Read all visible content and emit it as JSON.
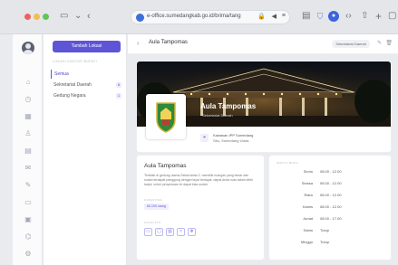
{
  "browser": {
    "url": "e-office.sumedangkab.go.id/brima/tang"
  },
  "sidebar_panel": {
    "add_button": "Tambah Lokasi",
    "caption": "LOKASI KANTOR BUPATI",
    "items": [
      {
        "label": "Semua",
        "count": ""
      },
      {
        "label": "Sekretariat Daerah",
        "count": "8"
      },
      {
        "label": "Gedung Negara",
        "count": "1"
      }
    ]
  },
  "header": {
    "title": "Aula Tampomas",
    "chip": "Sekretariat Daerah"
  },
  "hero": {
    "name": "Aula Tampomas",
    "subtitle": "Sekretariat Daerah",
    "location_line1": "Kawasan IPP Sumedang",
    "location_line2": "Situ, Sumedang Utara"
  },
  "info": {
    "title": "Aula Tampomas",
    "description": "Terletak di gedung utama Setda lantai 2, memiliki ruangan yang besar dan sudah terdapat panggung dengan layar berlayar, dapat Anda ruas tabah lebih lanjut, untuk penyewaan ini dapat bisa sudah.",
    "capacity_caption": "KAPASITAS",
    "capacity_value": "60-100 orang",
    "facility_caption": "FASILITAS"
  },
  "hours": {
    "caption": "WAKTU BUKA",
    "rows": [
      {
        "day": "Senin",
        "time": "08.00 - 12.00"
      },
      {
        "day": "Selasa",
        "time": "08.00 - 12.00"
      },
      {
        "day": "Rabu",
        "time": "08.00 - 12.00"
      },
      {
        "day": "Kamis",
        "time": "08.00 - 12.00"
      },
      {
        "day": "Jumat",
        "time": "08.00 - 17.00"
      },
      {
        "day": "Sabtu",
        "time": "Tutup"
      },
      {
        "day": "Minggu",
        "time": "Tutup"
      }
    ]
  },
  "colors": {
    "accent": "#5d55d6",
    "accent_light": "#efeefb"
  },
  "icons": {
    "facilities": [
      "tv-icon",
      "monitor-icon",
      "sound-icon",
      "wifi-icon",
      "ac-icon"
    ]
  }
}
